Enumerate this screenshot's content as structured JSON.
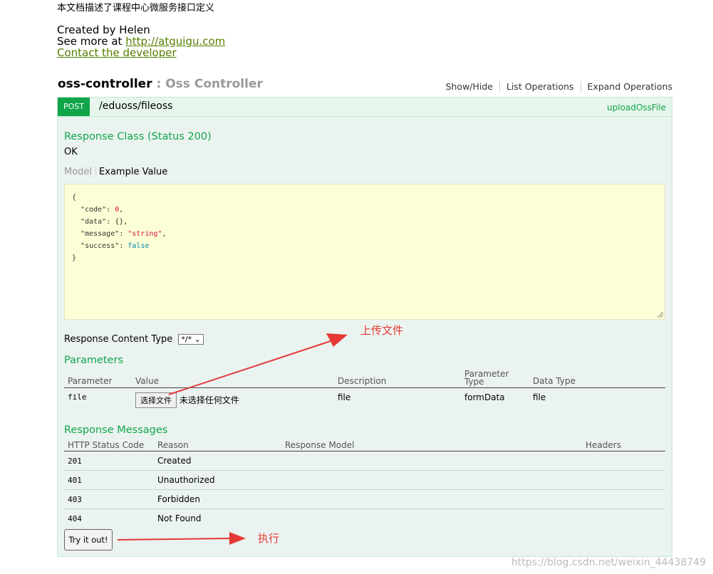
{
  "header": {
    "description": "本文档描述了课程中心微服务接口定义",
    "created_by": "Created by Helen",
    "see_more_prefix": "See more at ",
    "see_more_link": "http://atguigu.com",
    "contact": "Contact the developer"
  },
  "resource": {
    "name": "oss-controller",
    "separator": " : ",
    "description": "Oss Controller",
    "links": [
      "Show/Hide",
      "List Operations",
      "Expand Operations"
    ]
  },
  "operation": {
    "method": "POST",
    "path": "/eduoss/fileoss",
    "nickname": "uploadOssFile",
    "response_class_title": "Response Class (Status 200)",
    "response_class_value": "OK",
    "model_tab": "Model",
    "example_tab": "Example Value",
    "example_json": {
      "open": "{",
      "close": "}",
      "lines": [
        {
          "key": "\"code\"",
          "value": "0",
          "type": "number",
          "comma": ","
        },
        {
          "key": "\"data\"",
          "value": "{}",
          "type": "obj",
          "comma": ","
        },
        {
          "key": "\"message\"",
          "value": "\"string\"",
          "type": "string",
          "comma": ","
        },
        {
          "key": "\"success\"",
          "value": "false",
          "type": "bool",
          "comma": ""
        }
      ]
    },
    "response_content_type_label": "Response Content Type",
    "response_content_type_value": "*/*",
    "parameters_title": "Parameters",
    "parameters_headers": [
      "Parameter",
      "Value",
      "Description",
      "Parameter Type",
      "Data Type"
    ],
    "parameters": [
      {
        "name": "file",
        "button": "选择文件",
        "no_file": "未选择任何文件",
        "description": "file",
        "param_type": "formData",
        "data_type": "file"
      }
    ],
    "response_messages_title": "Response Messages",
    "response_headers": [
      "HTTP Status Code",
      "Reason",
      "Response Model",
      "Headers"
    ],
    "responses": [
      {
        "code": "201",
        "reason": "Created"
      },
      {
        "code": "401",
        "reason": "Unauthorized"
      },
      {
        "code": "403",
        "reason": "Forbidden"
      },
      {
        "code": "404",
        "reason": "Not Found"
      }
    ],
    "try_button": "Try it out!"
  },
  "annotations": {
    "upload": "上传文件",
    "execute": "执行"
  },
  "watermark": "https://blog.csdn.net/weixin_44438749",
  "colors": {
    "post": "#10a54a",
    "link": "#547f00",
    "annotation": "#e53935"
  }
}
